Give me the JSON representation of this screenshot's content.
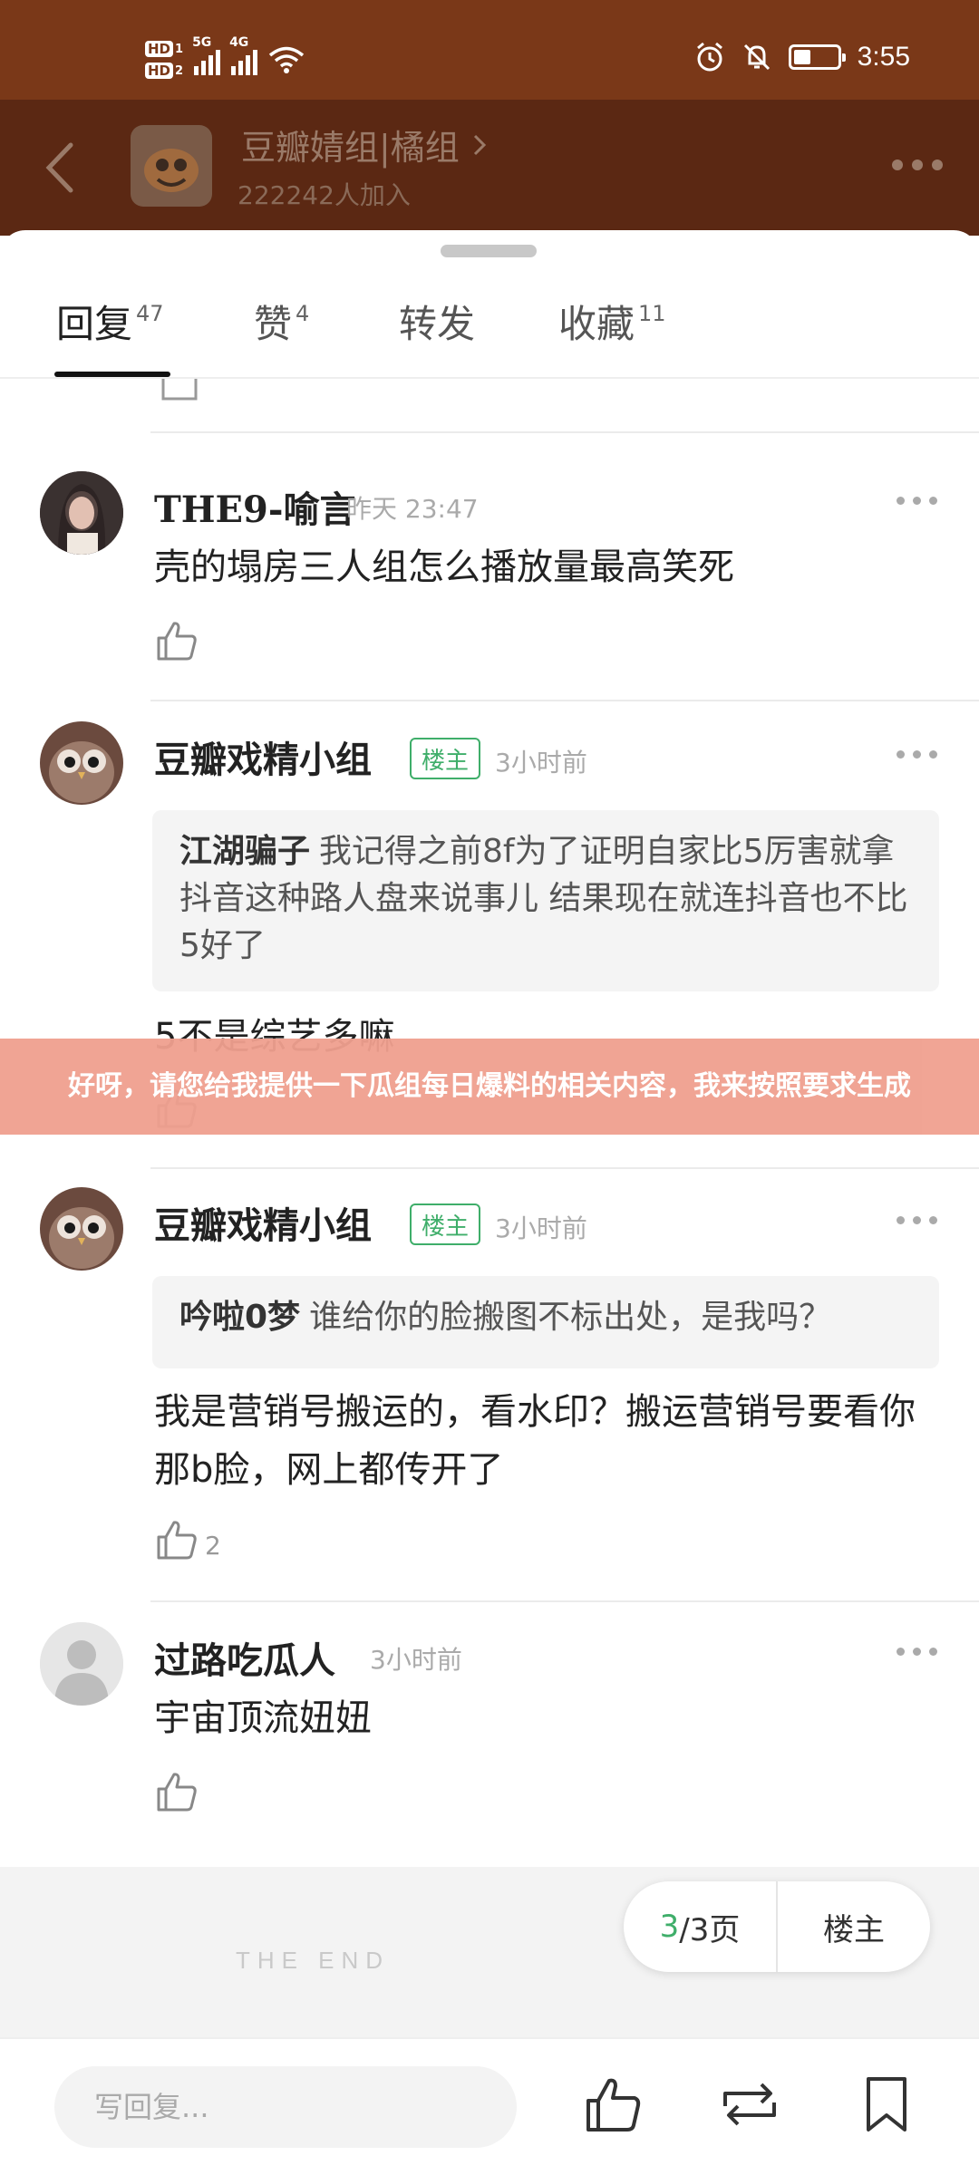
{
  "status_bar": {
    "sim1_label": "HD",
    "sim1_num": "1",
    "sim2_label": "HD",
    "sim2_num": "2",
    "signal1_label": "5G",
    "signal2_label": "4G",
    "battery_level": 0.4,
    "time": "3:55"
  },
  "header": {
    "group_name": "豆瓣婧组|橘组",
    "members": "222242人加入"
  },
  "tabs": [
    {
      "label": "回复",
      "count": "47"
    },
    {
      "label": "赞",
      "count": "4"
    },
    {
      "label": "转发",
      "count": ""
    },
    {
      "label": "收藏",
      "count": "11"
    }
  ],
  "comments": [
    {
      "user": "THE9-喻言",
      "time": "昨天 23:47",
      "text": "壳的塌房三人组怎么播放量最高笑死",
      "likes": ""
    },
    {
      "user": "豆瓣戏精小组",
      "badge": "楼主",
      "time": "3小时前",
      "quote_user": "江湖骗子",
      "quote_text": "我记得之前8f为了证明自家比5厉害就拿抖音这种路人盘来说事儿 结果现在就连抖音也不比5好了",
      "text": "5不是综艺多嘛",
      "likes": ""
    },
    {
      "user": "豆瓣戏精小组",
      "badge": "楼主",
      "time": "3小时前",
      "quote_user": "吟啦0梦",
      "quote_text": "谁给你的脸搬图不标出处，是我吗？",
      "text": "我是营销号搬运的，看水印？搬运营销号要看你那b脸，网上都传开了",
      "likes": "2"
    },
    {
      "user": "过路吃瓜人",
      "time": "3小时前",
      "text": "宇宙顶流妞妞",
      "likes": ""
    }
  ],
  "banner": "好呀，请您给我提供一下瓜组每日爆料的相关内容，我来按照要求生成",
  "end_label": "THE END",
  "pager": {
    "current": "3",
    "total": "/3页",
    "owner_only": "楼主"
  },
  "bottom_bar": {
    "reply_placeholder": "写回复..."
  },
  "colors": {
    "status_bar": "#7a3818",
    "header_dim": "#5b2813",
    "accent_green": "#3fae6a",
    "banner": "#f0a08f"
  }
}
